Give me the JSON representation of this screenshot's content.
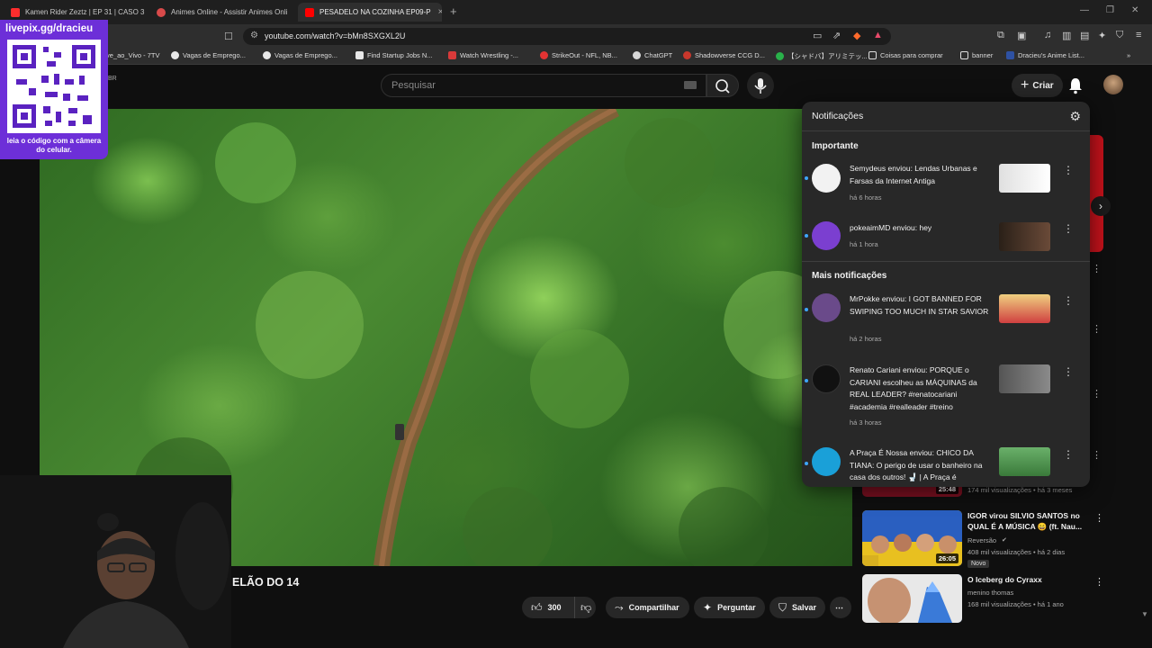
{
  "browser": {
    "tabs": [
      {
        "title": "Kamen Rider Zeztz | EP 31 | CASO 3",
        "fav_color": "#ff2d2d"
      },
      {
        "title": "Animes Online - Assistir Animes Onli",
        "fav_color": "#d84a4a"
      },
      {
        "title": "PESADELO NA COZINHA EP09-P",
        "fav_color": "#ff0000",
        "close": "×"
      }
    ],
    "new_tab": "+",
    "window_controls": [
      "—",
      "❐",
      "✕"
    ],
    "url": "youtube.com/watch?v=bMn8SXGXL2U",
    "bookmarks": [
      {
        "label": "ve_ao_Vivo - 7TV",
        "color": "#555"
      },
      {
        "label": "Vagas de Emprego...",
        "color": "#e8e8e8"
      },
      {
        "label": "Vagas de Emprego...",
        "color": "#e8e8e8"
      },
      {
        "label": "Find Startup Jobs N...",
        "color": "#e8e8e8"
      },
      {
        "label": "Watch Wrestling -...",
        "color": "#d83a3a"
      },
      {
        "label": "StrikeOut - NFL, NB...",
        "color": "#e23333"
      },
      {
        "label": "ChatGPT",
        "color": "#d8d8d8"
      },
      {
        "label": "Shadowverse CCG D...",
        "color": "#c8372c"
      },
      {
        "label": "【シャドバ】アリミテッ...",
        "color": "#29b14a"
      },
      {
        "label": "Coisas para comprar",
        "color": "#ffcc44"
      },
      {
        "label": "banner",
        "color": "#ffcc44"
      },
      {
        "label": "Dracieu's Anime List...",
        "color": "#2e51a2"
      }
    ],
    "bookmarks_more": "»"
  },
  "overlay": {
    "qr_title": "livepix.gg/dracieu",
    "qr_caption": "leia o código com a câmera do celular.",
    "country": "BR"
  },
  "header": {
    "search_placeholder": "Pesquisar",
    "create_label": "Criar",
    "create_icon": "+"
  },
  "video": {
    "title_partial": "ELÃO DO 14",
    "actions": {
      "likes": "300",
      "share": "Compartilhar",
      "ask": "Perguntar",
      "save": "Salvar",
      "more": "⋯"
    }
  },
  "notifications": {
    "title": "Notificações",
    "important_label": "Importante",
    "more_label": "Mais notificações",
    "items": [
      {
        "text": "Semydeus enviou: Lendas Urbanas e Farsas da Internet Antiga",
        "time": "há 6 horas",
        "avatar_color": "#f2f2f2",
        "thumb_color": "#d8d8d8"
      },
      {
        "text": "pokeaimMD enviou: hey",
        "time": "há 1 hora",
        "avatar_color": "#7b3fd0",
        "thumb_color": "#3a2a20"
      },
      {
        "text": "MrPokke enviou: I GOT BANNED FOR SWIPING TOO MUCH IN STAR SAVIOR",
        "time": "há 2 horas",
        "avatar_color": "#6a4a8a",
        "thumb_color": "#e8c070"
      },
      {
        "text": "Renato Cariani enviou: PORQUE o CARIANI escolheu as MÁQUINAS da REAL LEADER? #renatocariani #academia #realleader #treino",
        "time": "há 3 horas",
        "avatar_color": "#111111",
        "thumb_color": "#6a6a6a"
      },
      {
        "text": "A Praça É Nossa enviou: CHICO DA TIANA: O perigo de usar o banheiro na casa dos outros! 🚽 | A Praça é",
        "time": "",
        "avatar_color": "#1aa0d8",
        "thumb_color": "#4a9a4a"
      }
    ]
  },
  "recommendations": [
    {
      "title": "",
      "meta": "174 mil visualizações • há 3 meses",
      "duration": "25:48",
      "color": "#7a1020"
    },
    {
      "title": "IGOR virou SILVIO SANTOS no QUAL É A MÚSICA 😄 (ft. Nau...",
      "channel": "Reversão",
      "meta": "408 mil visualizações • há 2 dias",
      "duration": "26:05",
      "badge": "Novo",
      "color": "#e8c020"
    },
    {
      "title": "O Iceberg do Cyraxx",
      "channel": "menino thomas",
      "meta": "168 mil visualizações • há 1 ano",
      "duration": "",
      "color": "#3a7ad8"
    }
  ]
}
